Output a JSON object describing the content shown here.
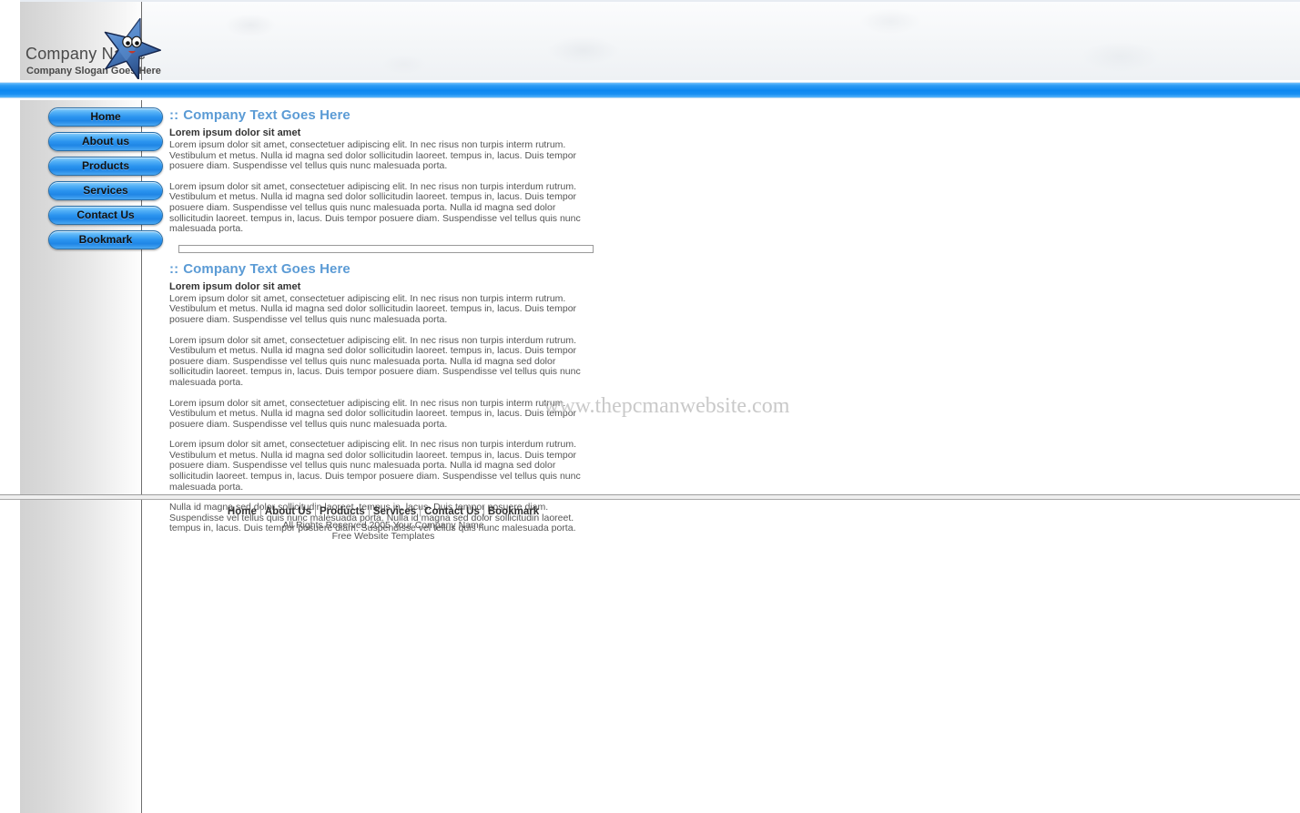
{
  "header": {
    "company_name": "Company Name",
    "slogan": "Company Slogan Goes Here",
    "logo_icon": "star-mascot-icon"
  },
  "sidebar": {
    "items": [
      {
        "label": "Home"
      },
      {
        "label": "About us"
      },
      {
        "label": "Products"
      },
      {
        "label": "Services"
      },
      {
        "label": "Contact Us"
      },
      {
        "label": "Bookmark"
      }
    ]
  },
  "content": {
    "sections": [
      {
        "marks": "::",
        "heading": "Company Text Goes Here",
        "subheading": "Lorem ipsum dolor sit amet",
        "paragraphs": [
          "Lorem ipsum dolor sit amet, consectetuer adipiscing elit. In nec risus non turpis interm rutrum. Vestibulum et metus. Nulla id magna sed dolor sollicitudin laoreet. tempus in, lacus. Duis tempor posuere diam. Suspendisse vel tellus quis nunc malesuada porta.",
          "Lorem ipsum dolor sit amet, consectetuer adipiscing elit. In nec risus non turpis interdum rutrum. Vestibulum et metus. Nulla id magna sed dolor sollicitudin laoreet. tempus in, lacus. Duis tempor posuere diam. Suspendisse vel tellus quis nunc malesuada porta. Nulla id magna sed dolor sollicitudin laoreet. tempus in, lacus. Duis tempor posuere diam. Suspendisse vel tellus quis nunc malesuada porta."
        ]
      },
      {
        "marks": "::",
        "heading": "Company Text Goes Here",
        "subheading": "Lorem ipsum dolor sit amet",
        "paragraphs": [
          "Lorem ipsum dolor sit amet, consectetuer adipiscing elit. In nec risus non turpis interm rutrum. Vestibulum et metus. Nulla id magna sed dolor sollicitudin laoreet. tempus in, lacus. Duis tempor posuere diam. Suspendisse vel tellus quis nunc malesuada porta.",
          "Lorem ipsum dolor sit amet, consectetuer adipiscing elit. In nec risus non turpis interdum rutrum. Vestibulum et metus. Nulla id magna sed dolor sollicitudin laoreet. tempus in, lacus. Duis tempor posuere diam. Suspendisse vel tellus quis nunc malesuada porta. Nulla id magna sed dolor sollicitudin laoreet. tempus in, lacus. Duis tempor posuere diam. Suspendisse vel tellus quis nunc malesuada porta.",
          "Lorem ipsum dolor sit amet, consectetuer adipiscing elit. In nec risus non turpis interm rutrum. Vestibulum et metus. Nulla id magna sed dolor sollicitudin laoreet. tempus in, lacus. Duis tempor posuere diam. Suspendisse vel tellus quis nunc malesuada porta.",
          "Lorem ipsum dolor sit amet, consectetuer adipiscing elit. In nec risus non turpis interdum rutrum. Vestibulum et metus. Nulla id magna sed dolor sollicitudin laoreet. tempus in, lacus. Duis tempor posuere diam. Suspendisse vel tellus quis nunc malesuada porta. Nulla id magna sed dolor sollicitudin laoreet. tempus in, lacus. Duis tempor posuere diam. Suspendisse vel tellus quis nunc malesuada porta.",
          "Nulla id magna sed dolor sollicitudin laoreet. tempus in, lacus. Duis tempor posuere diam. Suspendisse vel tellus quis nunc malesuada porta. Nulla id magna sed dolor sollicitudin laoreet. tempus in, lacus. Duis tempor posuere diam. Suspendisse vel tellus quis nunc malesuada porta."
        ]
      }
    ]
  },
  "watermark": {
    "text": "www.thepcmanwebsite.com"
  },
  "footer": {
    "nav": [
      {
        "label": "Home"
      },
      {
        "label": "About Us"
      },
      {
        "label": "Products"
      },
      {
        "label": "Services"
      },
      {
        "label": "Contact Us"
      },
      {
        "label": "Bookmark"
      }
    ],
    "separator": "|",
    "copyright": "All Rights Reserved 2005 Your Company Name",
    "tagline": "Free Website Templates"
  },
  "colors": {
    "accent_blue": "#5b9bd5",
    "bar_blue": "#0d87f0",
    "button_blue": "#2b94ef",
    "text_gray": "#555555",
    "watermark_gray": "#c9c9c9"
  }
}
